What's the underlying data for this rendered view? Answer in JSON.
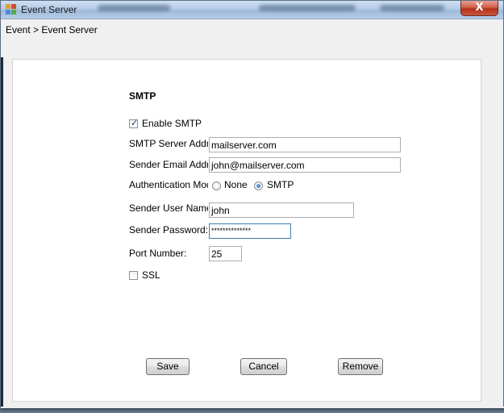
{
  "window": {
    "title": "Event Server",
    "close_glyph": "X"
  },
  "breadcrumb": "Event > Event Server",
  "form": {
    "section_title": "SMTP",
    "enable_smtp": {
      "label": "Enable SMTP",
      "checked": true
    },
    "smtp_server": {
      "label": "SMTP Server Address",
      "value": "mailserver.com"
    },
    "sender_email": {
      "label": "Sender Email Address",
      "value": "john@mailserver.com"
    },
    "auth_mode": {
      "label": "Authentication Mode",
      "options": [
        "None",
        "SMTP"
      ],
      "selected": "SMTP"
    },
    "sender_user": {
      "label": "Sender User Name",
      "value": "john"
    },
    "sender_password": {
      "label": "Sender Password:",
      "value": "**************"
    },
    "port": {
      "label": "Port Number:",
      "value": "25"
    },
    "ssl": {
      "label": "SSL",
      "checked": false
    }
  },
  "buttons": {
    "save": "Save",
    "cancel": "Cancel",
    "remove": "Remove"
  }
}
